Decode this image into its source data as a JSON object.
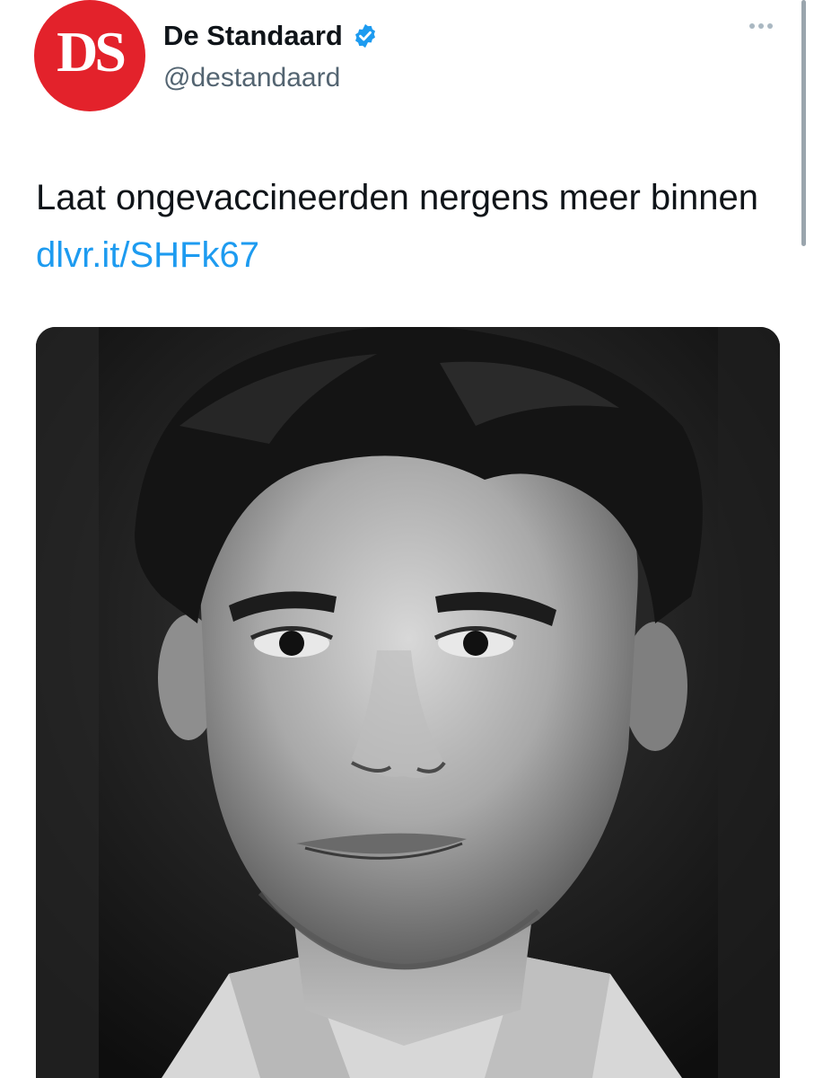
{
  "account": {
    "avatar_text": "DS",
    "display_name": "De Standaard",
    "handle": "@destandaard",
    "verified": true,
    "verified_icon": "verified-badge-icon",
    "avatar_color": "#e3222b"
  },
  "tweet": {
    "text": "Laat ongevaccineerden nergens meer binnen ",
    "link_text": "dlvr.it/SHFk67"
  },
  "menu": {
    "icon": "more-options-icon"
  },
  "colors": {
    "link": "#1d9bf0",
    "verified": "#1d9bf0",
    "text": "#0f1419",
    "secondary": "#536471"
  }
}
